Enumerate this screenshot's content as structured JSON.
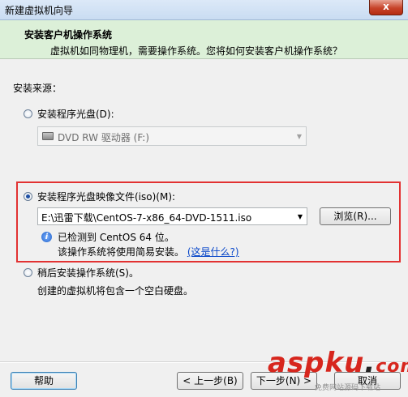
{
  "window": {
    "title": "新建虚拟机向导",
    "close_symbol": "x"
  },
  "header": {
    "title": "安装客户机操作系统",
    "subtitle": "虚拟机如同物理机，需要操作系统。您将如何安装客户机操作系统？"
  },
  "section_label": "安装来源：",
  "options": {
    "disc": {
      "label": "安装程序光盘(D):",
      "selected": false,
      "combo_value": "DVD RW 驱动器 (F:)"
    },
    "iso": {
      "label": "安装程序光盘映像文件(iso)(M):",
      "selected": true,
      "path": "E:\\迅雷下载\\CentOS-7-x86_64-DVD-1511.iso",
      "browse_label": "浏览(R)...",
      "detected": "已检测到 CentOS 64 位。",
      "easy_install": "该操作系统将使用简易安装。",
      "what_link": "(这是什么?)"
    },
    "later": {
      "label": "稍后安装操作系统(S)。",
      "selected": false,
      "description": "创建的虚拟机将包含一个空白硬盘。"
    }
  },
  "footer": {
    "help_label": "帮助",
    "back_label": "< 上一步(B)",
    "next_label": "下一步(N) >",
    "cancel_label": "取消"
  },
  "watermark": {
    "text": "aspku",
    "dot": ".",
    "tld": "com",
    "sub": "免费网站源码下载站"
  },
  "colors": {
    "header_bg": "#dcf0d8",
    "highlight": "#e23232",
    "link": "#0645c9",
    "wm_red": "#d7261d"
  }
}
